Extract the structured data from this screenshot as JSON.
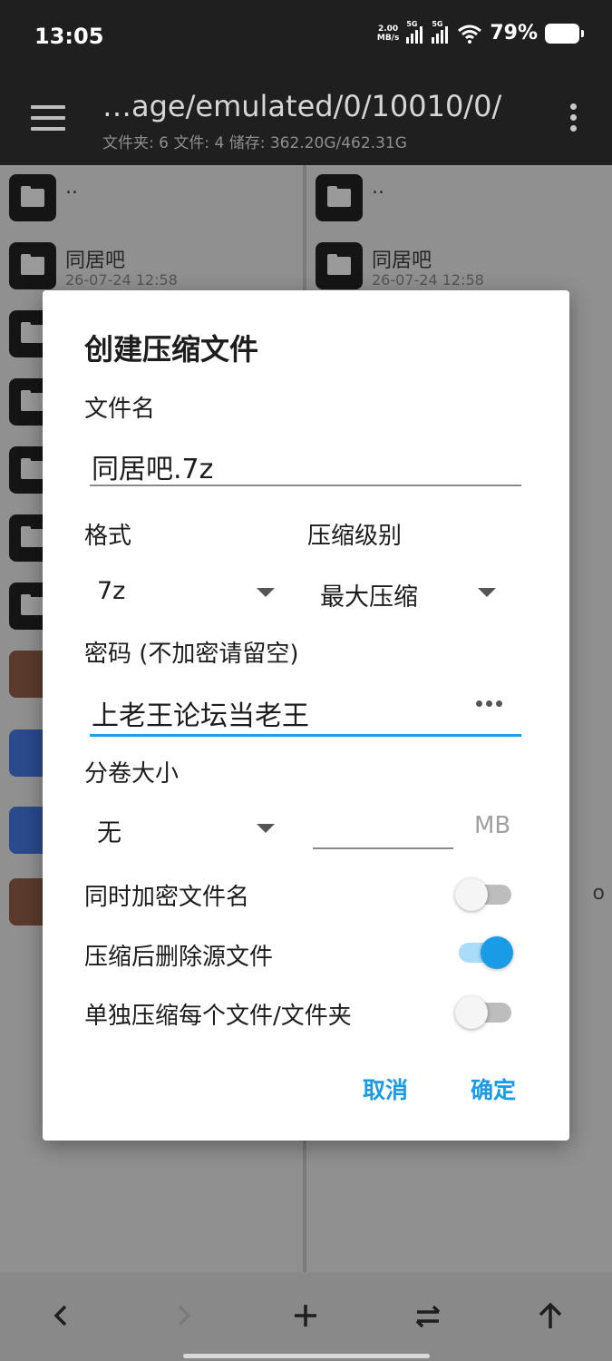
{
  "status_bar": {
    "time": "13:05",
    "net_speed_value": "2.00",
    "net_speed_unit": "MB/s",
    "signal1_label": "5G",
    "signal2_label": "5G",
    "battery": "79%"
  },
  "app_bar": {
    "path": "…age/emulated/0/10010/0/",
    "summary": "文件夹: 6  文件: 4  储存: 362.20G/462.31G"
  },
  "left_pane": {
    "parent": "..",
    "first_folder": {
      "name": "同居吧",
      "date": "26-07-24 12:58"
    }
  },
  "right_pane": {
    "parent": "..",
    "first_folder": {
      "name": "同居吧",
      "date": "26-07-24 12:58"
    },
    "partial_text": "o"
  },
  "dialog": {
    "title": "创建压缩文件",
    "filename_label": "文件名",
    "filename_value": "同居吧.7z",
    "format_label": "格式",
    "format_value": "7z",
    "level_label": "压缩级别",
    "level_value": "最大压缩",
    "password_label": "密码 (不加密请留空)",
    "password_value": "上老王论坛当老王",
    "volume_label": "分卷大小",
    "volume_value": "无",
    "volume_unit": "MB",
    "toggles": [
      {
        "label": "同时加密文件名",
        "on": false
      },
      {
        "label": "压缩后删除源文件",
        "on": true
      },
      {
        "label": "单独压缩每个文件/文件夹",
        "on": false
      }
    ],
    "cancel_label": "取消",
    "ok_label": "确定",
    "accent_color": "#1a9be6"
  },
  "bottom_bar": {
    "back_icon": "chevron-left-icon",
    "forward_icon": "chevron-right-icon",
    "add_icon": "plus-icon",
    "swap_icon": "swap-icon",
    "up_icon": "arrow-up-icon"
  }
}
